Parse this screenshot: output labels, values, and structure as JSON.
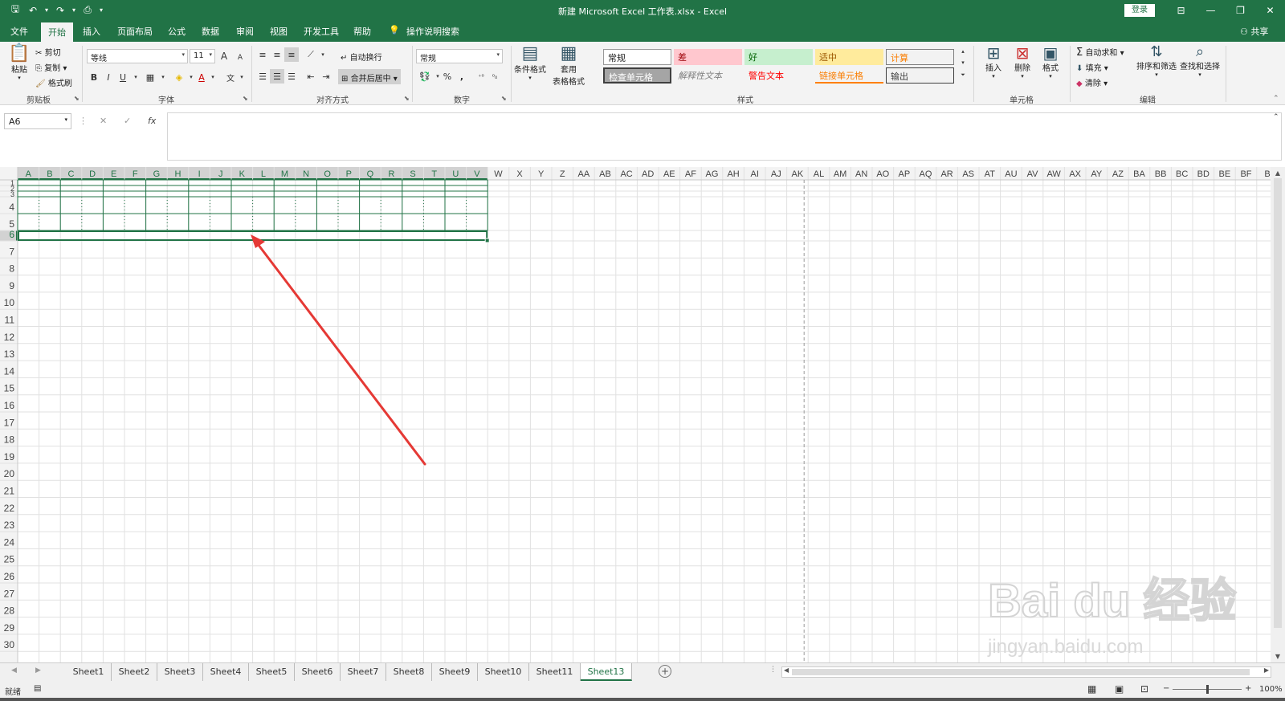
{
  "window": {
    "title": "新建 Microsoft Excel 工作表.xlsx  -  Excel",
    "login_label": "登录",
    "share_label": "共享",
    "accent_color": "#217346"
  },
  "quick_access": {
    "save_icon": "save-icon",
    "undo_icon": "undo-icon",
    "redo_icon": "redo-icon",
    "touch_icon": "touch-mode-icon",
    "customize_icon": "customize-icon"
  },
  "ribbon_tabs": [
    "文件",
    "开始",
    "插入",
    "页面布局",
    "公式",
    "数据",
    "审阅",
    "视图",
    "开发工具",
    "帮助",
    "操作说明搜索"
  ],
  "clipboard": {
    "paste_label": "粘贴",
    "cut_label": "剪切",
    "copy_label": "复制",
    "format_painter_label": "格式刷",
    "group_label": "剪贴板"
  },
  "font": {
    "font_name": "等线",
    "font_size": "11",
    "bold": "B",
    "italic": "I",
    "underline": "U",
    "grow": "A",
    "shrink": "A",
    "group_label": "字体"
  },
  "alignment": {
    "wrap_label": "自动换行",
    "merge_label": "合并后居中",
    "group_label": "对齐方式"
  },
  "number": {
    "format": "常规",
    "percent": "%",
    "comma": ",",
    "group_label": "数字"
  },
  "styles": {
    "conditional_label": "条件格式",
    "table_label_1": "套用",
    "table_label_2": "表格格式",
    "cells": [
      {
        "label": "常规"
      },
      {
        "label": "差"
      },
      {
        "label": "好"
      },
      {
        "label": "适中"
      },
      {
        "label": "计算"
      },
      {
        "label": "检查单元格"
      },
      {
        "label": "解释性文本"
      },
      {
        "label": "警告文本"
      },
      {
        "label": "链接单元格"
      },
      {
        "label": "输出"
      }
    ],
    "group_label": "样式"
  },
  "cells_group": {
    "insert_label": "插入",
    "delete_label": "删除",
    "format_label": "格式",
    "group_label": "单元格"
  },
  "editing": {
    "autosum_label": "自动求和",
    "fill_label": "填充",
    "clear_label": "清除",
    "sort_label": "排序和筛选",
    "find_label": "查找和选择",
    "group_label": "编辑"
  },
  "formula_bar": {
    "name_box": "A6",
    "cancel": "✕",
    "enter": "✓",
    "fx": "fx",
    "content": ""
  },
  "columns": [
    "A",
    "B",
    "C",
    "D",
    "E",
    "F",
    "G",
    "H",
    "I",
    "J",
    "K",
    "L",
    "M",
    "N",
    "O",
    "P",
    "Q",
    "R",
    "S",
    "T",
    "U",
    "V",
    "W",
    "X",
    "Y",
    "Z",
    "AA",
    "AB",
    "AC",
    "AD",
    "AE",
    "AF",
    "AG",
    "AH",
    "AI",
    "AJ",
    "AK",
    "AL",
    "AM",
    "AN",
    "AO",
    "AP",
    "AQ",
    "AR",
    "AS",
    "AT",
    "AU",
    "AV",
    "AW",
    "AX",
    "AY",
    "AZ",
    "BA",
    "BB",
    "BC",
    "BD",
    "BE",
    "BF",
    "B"
  ],
  "rows": [
    "1",
    "2",
    "3",
    "4",
    "5",
    "6",
    "7",
    "8",
    "9",
    "10",
    "11",
    "12",
    "13",
    "14",
    "15",
    "16",
    "17",
    "18",
    "19",
    "20",
    "21",
    "22",
    "23",
    "24",
    "25",
    "26",
    "27",
    "28",
    "29",
    "30"
  ],
  "sheets": [
    "Sheet1",
    "Sheet2",
    "Sheet3",
    "Sheet4",
    "Sheet5",
    "Sheet6",
    "Sheet7",
    "Sheet8",
    "Sheet9",
    "Sheet10",
    "Sheet11",
    "Sheet13"
  ],
  "active_sheet": "Sheet13",
  "status": {
    "ready": "就绪",
    "zoom": "100%"
  },
  "watermark": {
    "logo": "Bai du 经验",
    "url": "jingyan.baidu.com"
  }
}
